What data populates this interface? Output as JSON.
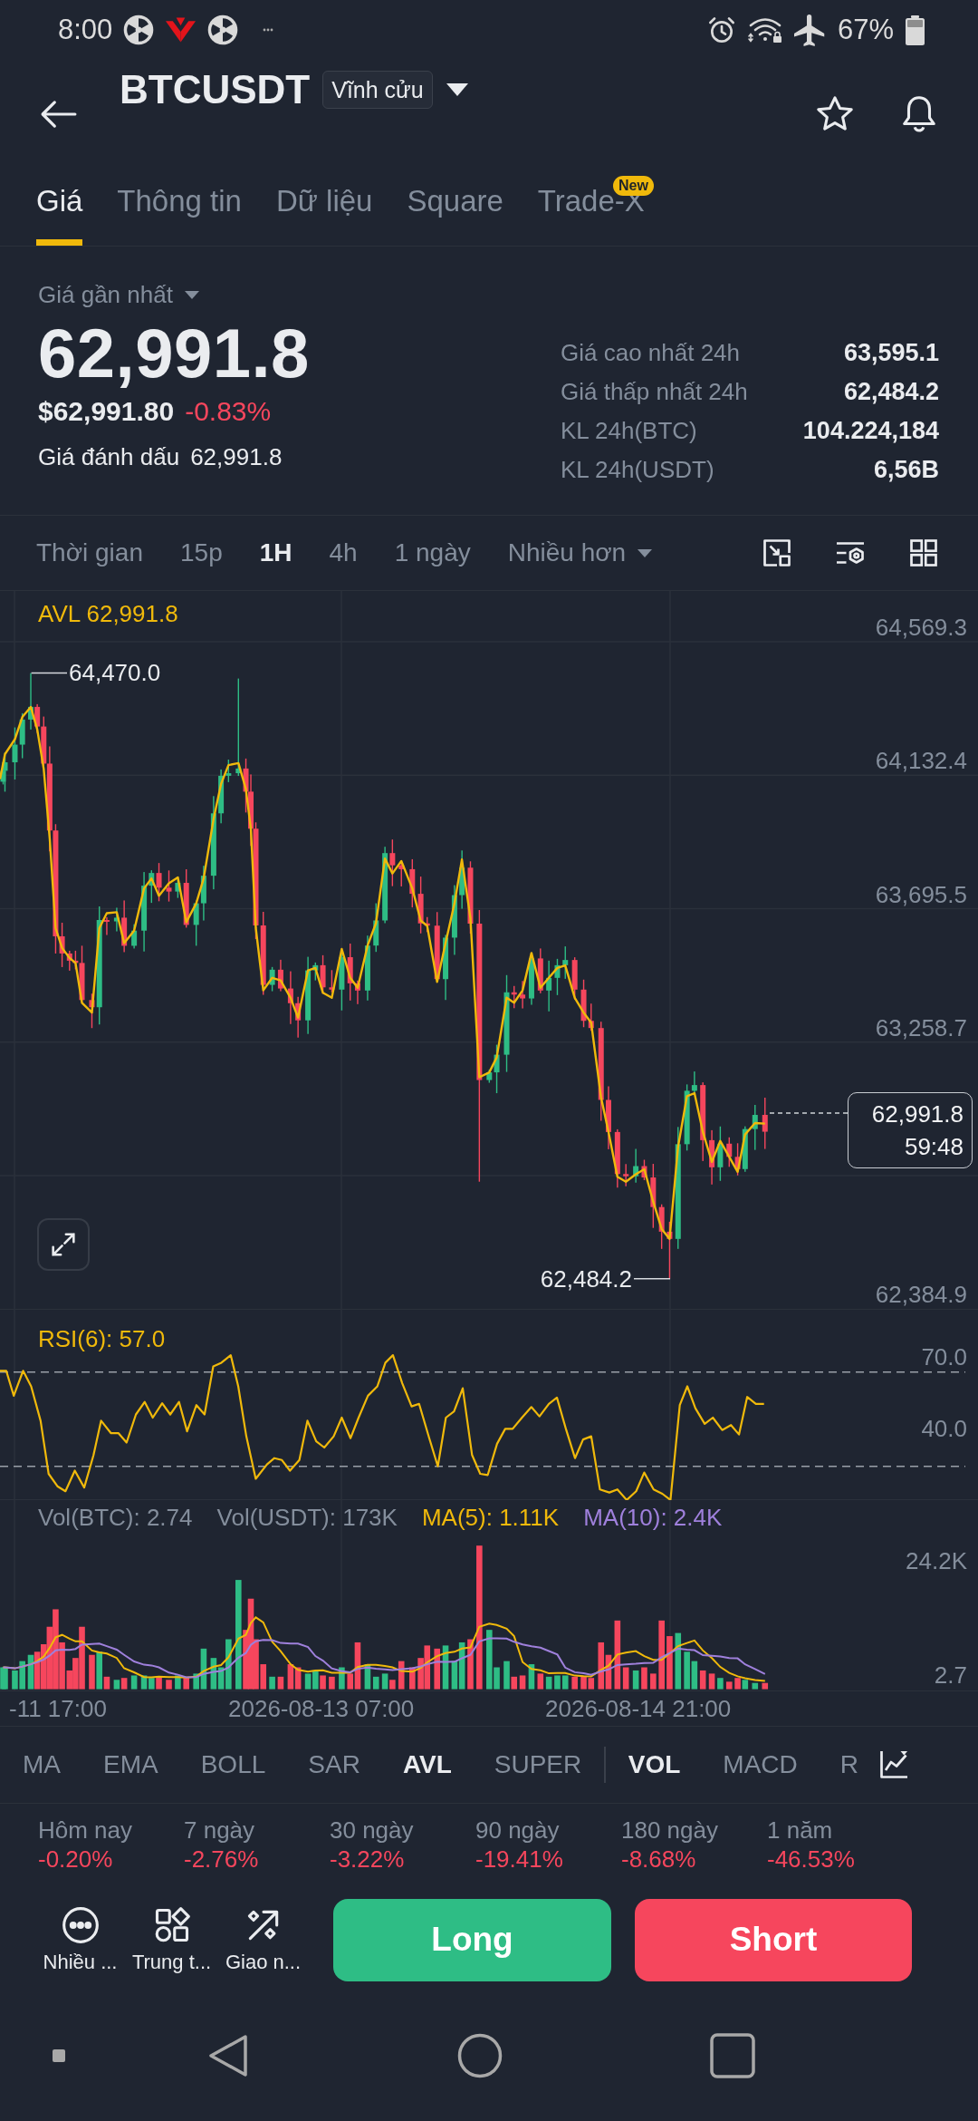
{
  "status_bar": {
    "time": "8:00",
    "battery": "67%"
  },
  "header": {
    "symbol": "BTCUSDT",
    "contract_type": "Vĩnh cửu"
  },
  "tabs": [
    {
      "label": "Giá",
      "selected": true
    },
    {
      "label": "Thông tin",
      "selected": false
    },
    {
      "label": "Dữ liệu",
      "selected": false
    },
    {
      "label": "Square",
      "selected": false
    },
    {
      "label": "Trade-X",
      "selected": false,
      "badge": "New"
    }
  ],
  "price_summary": {
    "price_type": "Giá gần nhất",
    "last_price": "62,991.8",
    "usd_price": "$62,991.80",
    "change": "-0.83%",
    "mark_price_label": "Giá đánh dấu",
    "mark_price": "62,991.8",
    "stats": [
      {
        "label": "Giá cao nhất 24h",
        "value": "63,595.1"
      },
      {
        "label": "Giá thấp nhất 24h",
        "value": "62,484.2"
      },
      {
        "label": "KL 24h(BTC)",
        "value": "104.224,184"
      },
      {
        "label": "KL 24h(USDT)",
        "value": "6,56B"
      }
    ]
  },
  "interval_bar": {
    "label": "Thời gian",
    "options": [
      {
        "label": "15p",
        "selected": false
      },
      {
        "label": "1H",
        "selected": true
      },
      {
        "label": "4h",
        "selected": false
      },
      {
        "label": "1 ngày",
        "selected": false
      }
    ],
    "more": "Nhiều hơn"
  },
  "main_chart": {
    "indicator_label": "AVL 62,991.8",
    "y_axis": [
      "64,569.3",
      "64,132.4",
      "63,695.5",
      "63,258.7",
      "62,384.9"
    ],
    "high_label": "64,470.0",
    "low_label": "62,484.2",
    "last_price": "62,991.8",
    "countdown": "59:48"
  },
  "rsi": {
    "label": "RSI(6): 57.0",
    "y_axis": [
      "70.0",
      "40.0"
    ]
  },
  "volume": {
    "legend": [
      {
        "text": "Vol(BTC): 2.74",
        "color": "#848e9c"
      },
      {
        "text": "Vol(USDT): 173K",
        "color": "#848e9c"
      },
      {
        "text": "MA(5): 1.11K",
        "color": "#f0b90b"
      },
      {
        "text": "MA(10): 2.4K",
        "color": "#9f80dc"
      }
    ],
    "y_axis": [
      "24.2K",
      "2.7"
    ]
  },
  "x_axis": [
    "-11 17:00",
    "2026-08-13 07:00",
    "2026-08-14 21:00"
  ],
  "indicators": {
    "main": [
      {
        "label": "MA",
        "selected": false
      },
      {
        "label": "EMA",
        "selected": false
      },
      {
        "label": "BOLL",
        "selected": false
      },
      {
        "label": "SAR",
        "selected": false
      },
      {
        "label": "AVL",
        "selected": true
      },
      {
        "label": "SUPER",
        "selected": false
      }
    ],
    "sub": [
      {
        "label": "VOL",
        "selected": true
      },
      {
        "label": "MACD",
        "selected": false
      },
      {
        "label": "R",
        "selected": false
      }
    ]
  },
  "performance": [
    {
      "period": "Hôm nay",
      "change": "-0.20%"
    },
    {
      "period": "7 ngày",
      "change": "-2.76%"
    },
    {
      "period": "30 ngày",
      "change": "-3.22%"
    },
    {
      "period": "90 ngày",
      "change": "-19.41%"
    },
    {
      "period": "180 ngày",
      "change": "-8.68%"
    },
    {
      "period": "1 năm",
      "change": "-46.53%"
    }
  ],
  "shortcuts": [
    {
      "label": "Nhiều ..."
    },
    {
      "label": "Trung t..."
    },
    {
      "label": "Giao n..."
    }
  ],
  "trade_buttons": [
    {
      "label": "Long",
      "kind": "long"
    },
    {
      "label": "Short",
      "kind": "short"
    }
  ]
}
